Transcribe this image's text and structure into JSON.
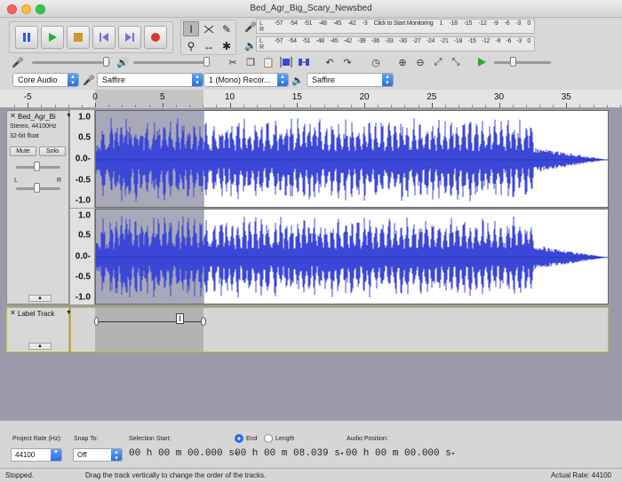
{
  "window": {
    "title": "Bed_Agr_Big_Scary_Newsbed"
  },
  "meters": {
    "record": {
      "left": "L",
      "right": "R",
      "ticks": [
        "-57",
        "-54",
        "-51",
        "-48",
        "-45",
        "-42",
        "-3",
        "Click to Start Monitoring",
        "1",
        "-18",
        "-15",
        "-12",
        "-9",
        "-6",
        "-3",
        "0"
      ]
    },
    "playback": {
      "left": "L",
      "right": "R",
      "ticks": [
        "-57",
        "-54",
        "-51",
        "-48",
        "-45",
        "-42",
        "-39",
        "-36",
        "-33",
        "-30",
        "-27",
        "-24",
        "-21",
        "-18",
        "-15",
        "-12",
        "-9",
        "-6",
        "-3",
        "0"
      ]
    }
  },
  "device": {
    "host": "Core Audio",
    "recording_device": "Saffire",
    "channels": "1 (Mono) Recor...",
    "playback_device": "Saffire"
  },
  "ruler": {
    "labels": [
      {
        "t": "-5"
      },
      {
        "t": "0"
      },
      {
        "t": "5"
      },
      {
        "t": "10"
      },
      {
        "t": "15"
      },
      {
        "t": "20"
      },
      {
        "t": "25"
      },
      {
        "t": "30"
      },
      {
        "t": "35"
      }
    ]
  },
  "audio_track": {
    "name": "Bed_Agr_Bi",
    "info_line1": "Stereo, 44100Hz",
    "info_line2": "32-bit float",
    "mute_label": "Mute",
    "solo_label": "Solo",
    "gain_label_l": "L",
    "gain_label_r": "R",
    "scale": [
      "1.0",
      "0.5",
      "0.0-",
      "-0.5",
      "-1.0"
    ],
    "selection_start_s": 0.0,
    "selection_end_s": 8.039,
    "waveform_color": "#3b47d6"
  },
  "label_track": {
    "name": "Label Track",
    "label_text": "I"
  },
  "selection_toolbar": {
    "project_rate_label": "Project Rate (Hz):",
    "project_rate_value": "44100",
    "snap_to_label": "Snap To:",
    "snap_to_value": "Off",
    "selection_start_label": "Selection Start:",
    "end_label": "End",
    "length_label": "Length",
    "audio_position_label": "Audio Position:",
    "selection_start_time": "00 h 00 m 00.000 s",
    "selection_end_time": "00 h 00 m 08.039 s",
    "audio_position_time": "00 h 00 m 00.000 s"
  },
  "status": {
    "state": "Stopped.",
    "hint": "Drag the track vertically to change the order of the tracks.",
    "actual_rate": "Actual Rate: 44100"
  },
  "colors": {
    "selection_fill": "#a9a8b8",
    "track_background": "#9b9aaa",
    "accent": "#2a6ee0"
  }
}
